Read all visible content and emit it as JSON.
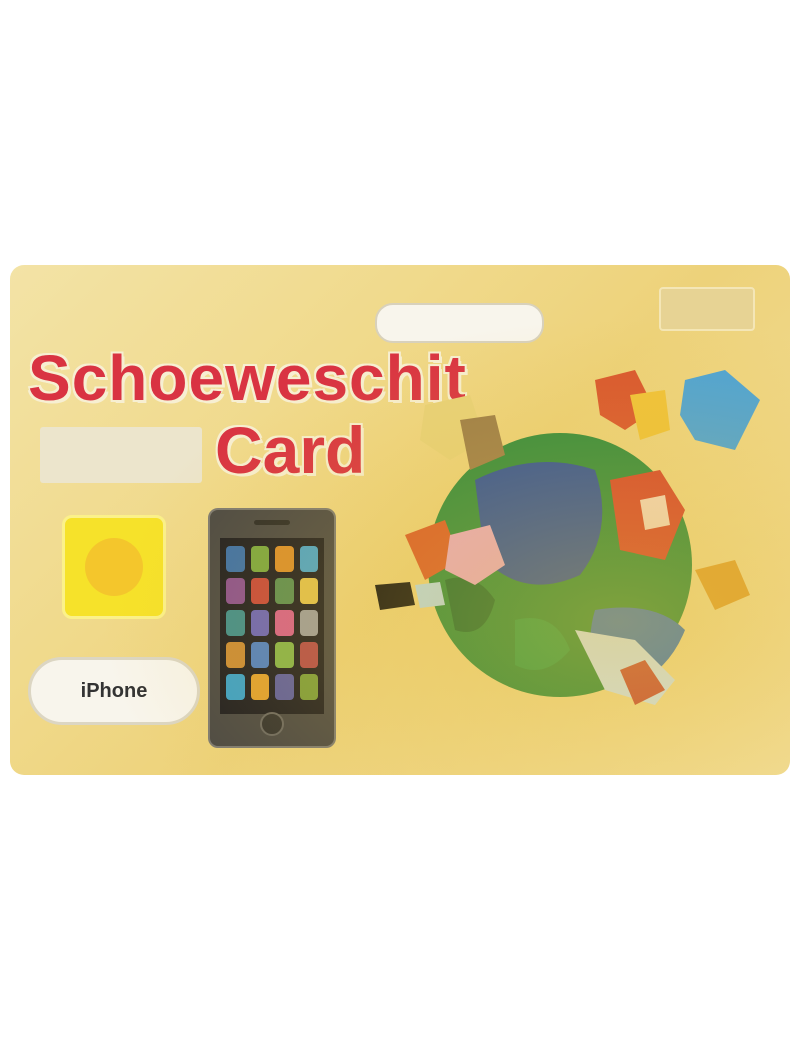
{
  "card": {
    "header_line_1": "",
    "header_line_2": "",
    "brand_pill": "",
    "corner_label": "",
    "title_main": "Schoeweschit",
    "subtitle_line_1": "",
    "subtitle_line_2": "",
    "title_card": "Card",
    "badge_text": "",
    "device_pill": "iPhone"
  },
  "colors": {
    "card_gold": "#f0d98a",
    "title_red": "#d93342",
    "subtitle_blue": "#8fb1cf",
    "badge_yellow": "#f6e22a",
    "phone_body": "#4a4845"
  },
  "phone": {
    "app_icon_colors": [
      "#3b6fa8",
      "#7aa640",
      "#d98e2c",
      "#4aa3c9",
      "#8a4f8f",
      "#c6473c",
      "#5b8c52",
      "#e1c14d",
      "#3f8c8c",
      "#6a63b8",
      "#d65f8a",
      "#9c9c9c",
      "#c98a36",
      "#4f7fc2",
      "#85b24a",
      "#b24a4a",
      "#3aa0c8",
      "#e0a030",
      "#5d5d9e",
      "#7b9c3c"
    ]
  },
  "icons": {
    "globe": "globe-illustration-icon",
    "badge": "seal-badge-icon",
    "phone": "smartphone-icon"
  }
}
